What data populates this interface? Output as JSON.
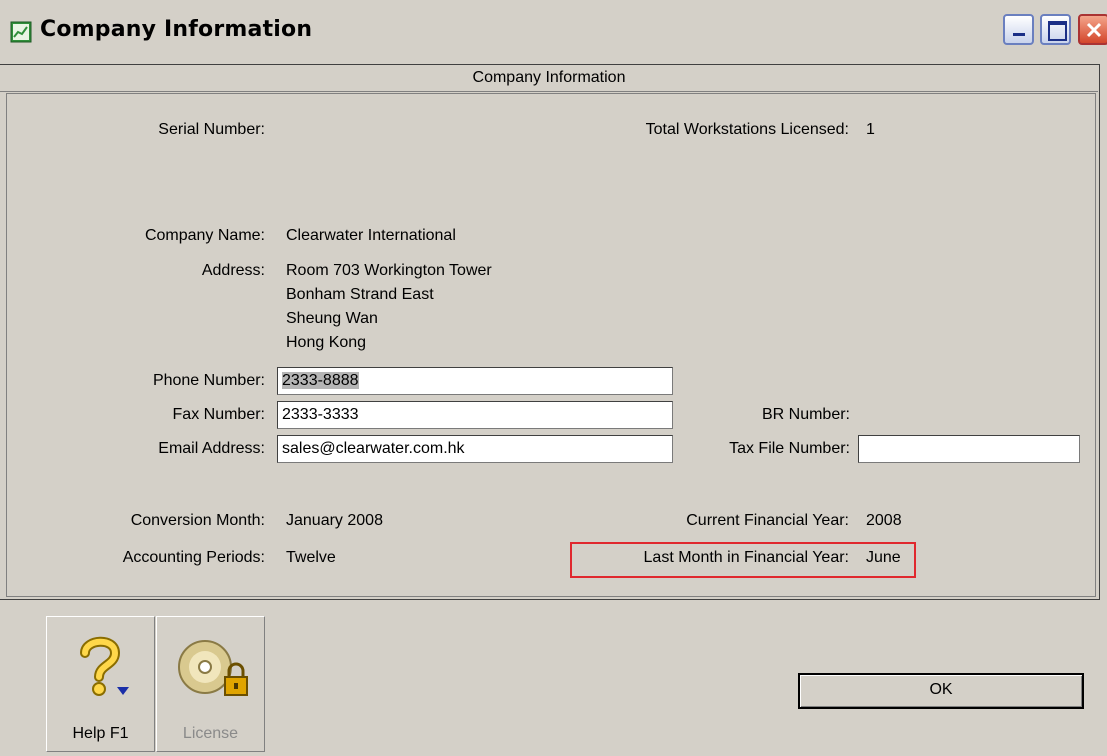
{
  "window": {
    "title": "Company Information",
    "title_icon": "spreadsheet-app-icon"
  },
  "panel": {
    "header": "Company Information",
    "serial_number_label": "Serial Number:",
    "serial_number_value": "",
    "workstations_label": "Total Workstations Licensed:",
    "workstations_value": "1",
    "company_name_label": "Company Name:",
    "company_name_value": "Clearwater International",
    "address_label": "Address:",
    "address_lines": [
      "Room 703 Workington Tower",
      "Bonham Strand East",
      "Sheung Wan",
      "Hong Kong"
    ],
    "phone_label": "Phone Number:",
    "phone_value": "2333-8888",
    "fax_label": "Fax Number:",
    "fax_value": "2333-3333",
    "email_label": "Email Address:",
    "email_value": "sales@clearwater.com.hk",
    "br_label": "BR Number:",
    "br_value": "",
    "tax_label": "Tax File Number:",
    "tax_value": "",
    "conversion_label": "Conversion Month:",
    "conversion_value": "January 2008",
    "periods_label": "Accounting Periods:",
    "periods_value": "Twelve",
    "fin_year_label": "Current Financial Year:",
    "fin_year_value": "2008",
    "last_month_label": "Last Month in Financial Year:",
    "last_month_value": "June"
  },
  "toolbar": {
    "help_label": "Help F1",
    "license_label": "License",
    "ok_label": "OK"
  },
  "colors": {
    "highlight": "#e0282e",
    "window_bg": "#d4d0c8"
  }
}
